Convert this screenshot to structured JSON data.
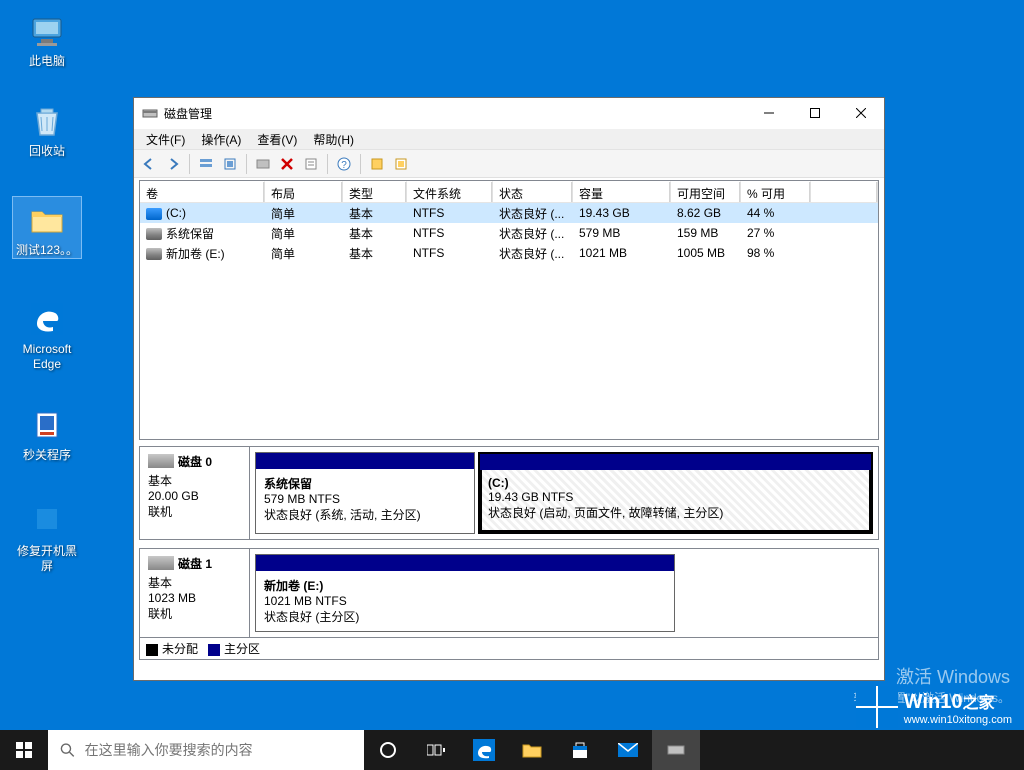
{
  "desktop_icons": [
    {
      "label": "此电脑"
    },
    {
      "label": "回收站"
    },
    {
      "label": "测试123。。"
    },
    {
      "label": "Microsoft\nEdge"
    },
    {
      "label": "秒关程序"
    },
    {
      "label": "修复开机黑屏"
    }
  ],
  "window": {
    "title": "磁盘管理",
    "menu": [
      "文件(F)",
      "操作(A)",
      "查看(V)",
      "帮助(H)"
    ]
  },
  "columns": [
    "卷",
    "布局",
    "类型",
    "文件系统",
    "状态",
    "容量",
    "可用空间",
    "% 可用"
  ],
  "volumes": [
    {
      "name": "(C:)",
      "layout": "简单",
      "type": "基本",
      "fs": "NTFS",
      "status": "状态良好 (...",
      "capacity": "19.43 GB",
      "free": "8.62 GB",
      "pct": "44 %",
      "selected": true
    },
    {
      "name": "系统保留",
      "layout": "简单",
      "type": "基本",
      "fs": "NTFS",
      "status": "状态良好 (...",
      "capacity": "579 MB",
      "free": "159 MB",
      "pct": "27 %"
    },
    {
      "name": "新加卷 (E:)",
      "layout": "简单",
      "type": "基本",
      "fs": "NTFS",
      "status": "状态良好 (...",
      "capacity": "1021 MB",
      "free": "1005 MB",
      "pct": "98 %"
    }
  ],
  "disks": {
    "disk0": {
      "name": "磁盘 0",
      "type": "基本",
      "size": "20.00 GB",
      "status": "联机"
    },
    "disk0_p1": {
      "name": "系统保留",
      "sub": "579 MB NTFS",
      "status": "状态良好 (系统, 活动, 主分区)"
    },
    "disk0_p2": {
      "name": "(C:)",
      "sub": "19.43 GB NTFS",
      "status": "状态良好 (启动, 页面文件, 故障转储, 主分区)"
    },
    "disk1": {
      "name": "磁盘 1",
      "type": "基本",
      "size": "1023 MB",
      "status": "联机"
    },
    "disk1_p1": {
      "name": "新加卷  (E:)",
      "sub": "1021 MB NTFS",
      "status": "状态良好 (主分区)"
    }
  },
  "legend": {
    "unalloc": "未分配",
    "primary": "主分区"
  },
  "watermark": {
    "l1": "激活 Windows",
    "l2": "转到\"设置\"以激活 Windows。"
  },
  "brand": {
    "name": "Win10",
    "suffix": "之家",
    "url": "www.win10xitong.com"
  },
  "search": {
    "placeholder": "在这里输入你要搜索的内容"
  }
}
